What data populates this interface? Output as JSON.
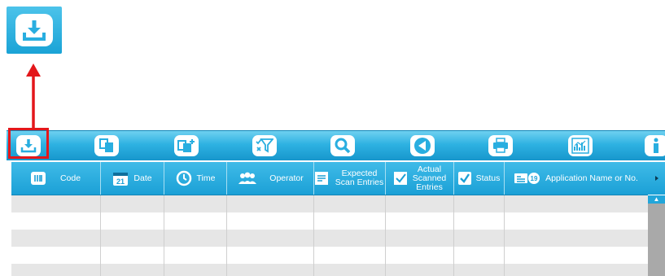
{
  "callout": {
    "icon": "download-icon"
  },
  "toolbar": {
    "buttons": [
      {
        "name": "download-button",
        "icon": "download-icon"
      },
      {
        "name": "copy-button",
        "icon": "copy-icon"
      },
      {
        "name": "copy-add-button",
        "icon": "copy-add-icon"
      },
      {
        "name": "filter-button",
        "icon": "filter-icon"
      },
      {
        "name": "search-button",
        "icon": "search-icon"
      },
      {
        "name": "back-button",
        "icon": "back-triangle-icon"
      },
      {
        "name": "print-button",
        "icon": "print-icon"
      },
      {
        "name": "report-button",
        "icon": "chart-icon"
      },
      {
        "name": "info-button",
        "icon": "info-icon"
      }
    ]
  },
  "table": {
    "columns": [
      {
        "key": "code",
        "label": "Code",
        "icon": "barcode-icon"
      },
      {
        "key": "date",
        "label": "Date",
        "icon": "calendar-icon",
        "icon_text": "21"
      },
      {
        "key": "time",
        "label": "Time",
        "icon": "clock-icon"
      },
      {
        "key": "operator",
        "label": "Operator",
        "icon": "users-icon"
      },
      {
        "key": "expected",
        "label": "Expected Scan Entries",
        "icon": "scan-icon"
      },
      {
        "key": "actual",
        "label": "Actual Scanned Entries",
        "icon": "checklist-icon"
      },
      {
        "key": "status",
        "label": "Status",
        "icon": "checkbox-icon"
      },
      {
        "key": "application",
        "label": "Application Name or No.",
        "icon": "id-card-icon",
        "icon_text": "19"
      }
    ],
    "row_count": 5
  },
  "colors": {
    "toolbar_blue": "#2eb2e2",
    "header_blue": "#1ba0d6",
    "highlight_red": "#e3171b",
    "row_alt": "#e6e6e6"
  }
}
